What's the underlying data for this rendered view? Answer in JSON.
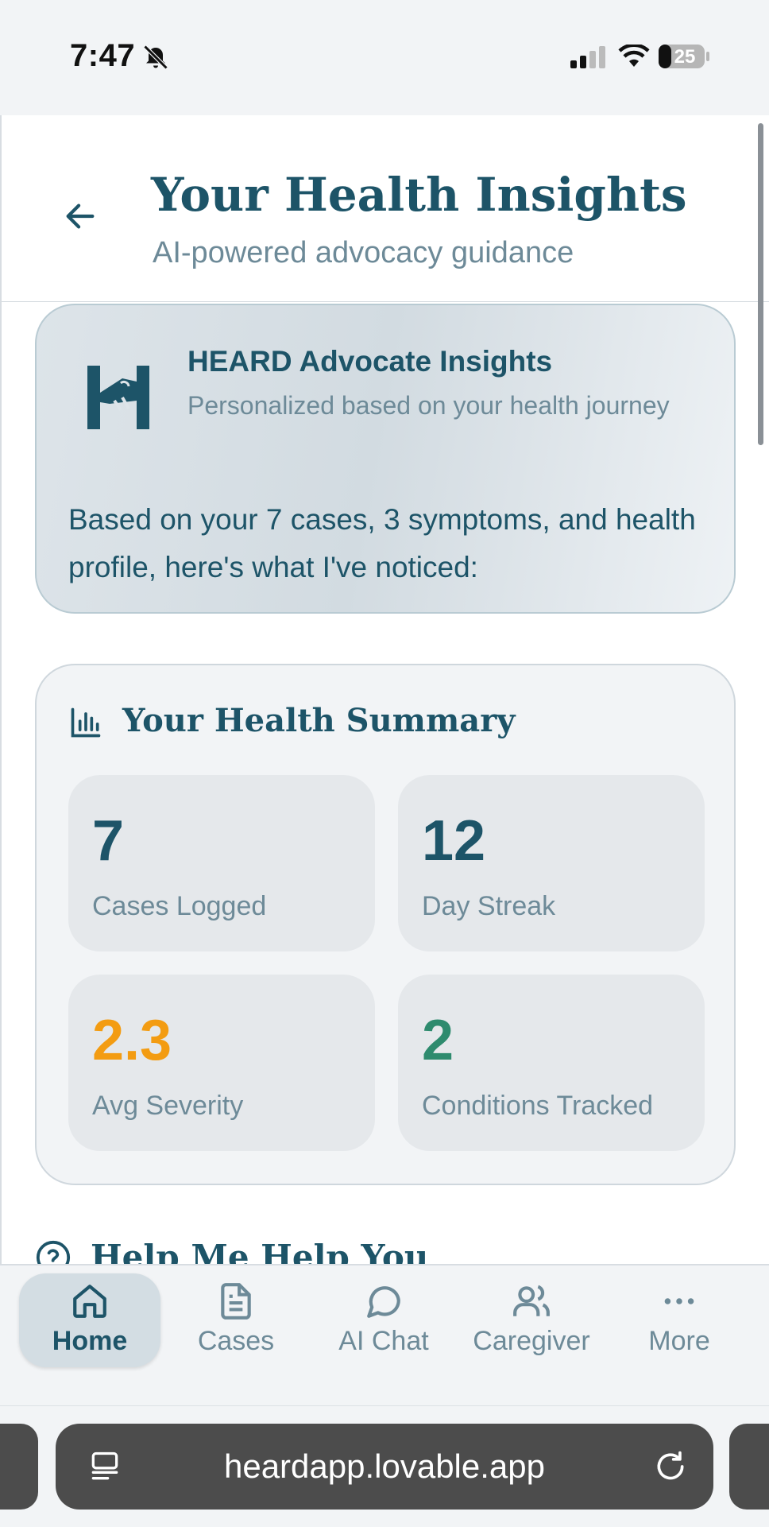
{
  "status_bar": {
    "time": "7:47",
    "battery": "25"
  },
  "header": {
    "title": "Your Health Insights",
    "subtitle": "AI-powered advocacy guidance"
  },
  "insight_card": {
    "title": "HEARD Advocate Insights",
    "subtitle": "Personalized based on your health journey",
    "body": "Based on your 7 cases, 3 symptoms, and health profile, here's what I've noticed:"
  },
  "summary": {
    "title": "Your Health Summary",
    "stats": [
      {
        "value": "7",
        "label": "Cases Logged",
        "color": "#1d5468"
      },
      {
        "value": "12",
        "label": "Day Streak",
        "color": "#1d5468"
      },
      {
        "value": "2.3",
        "label": "Avg Severity",
        "color": "#f39c12"
      },
      {
        "value": "2",
        "label": "Conditions Tracked",
        "color": "#2e8b6e"
      }
    ]
  },
  "help_section": {
    "title": "Help Me Help You"
  },
  "bottom_nav": {
    "items": [
      {
        "label": "Home",
        "icon": "home-icon",
        "active": true
      },
      {
        "label": "Cases",
        "icon": "document-icon"
      },
      {
        "label": "AI Chat",
        "icon": "chat-bubble-icon"
      },
      {
        "label": "Caregiver",
        "icon": "users-icon"
      },
      {
        "label": "More",
        "icon": "ellipsis-icon"
      }
    ]
  },
  "browser": {
    "url": "heardapp.lovable.app"
  },
  "colors": {
    "primary": "#1d5468",
    "muted": "#6d8a98",
    "warning": "#f39c12",
    "success": "#2e8b6e"
  }
}
